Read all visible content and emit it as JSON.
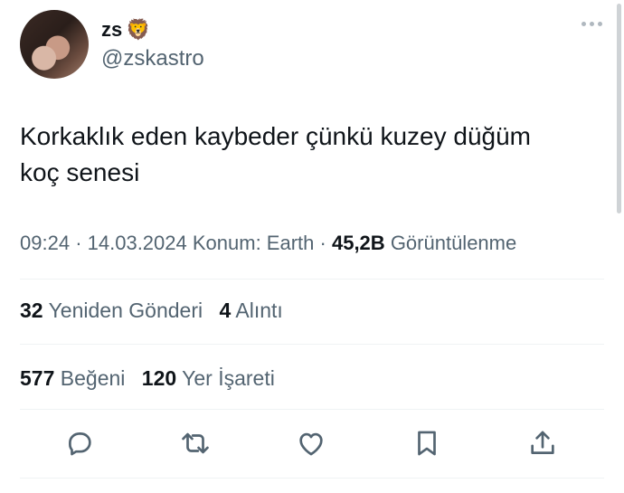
{
  "user": {
    "name": "zs",
    "emoji": "🦁",
    "handle": "@zskastro"
  },
  "tweet": {
    "text_line1": "Korkaklık eden kaybeder çünkü kuzey düğüm",
    "text_line2": "koç senesi"
  },
  "meta": {
    "time": "09:24",
    "date": "14.03.2024",
    "location": "Konum: Earth",
    "views_count": "45,2B",
    "views_label": "Görüntülenme"
  },
  "stats": {
    "reposts_count": "32",
    "reposts_label": "Yeniden Gönderi",
    "quotes_count": "4",
    "quotes_label": "Alıntı",
    "likes_count": "577",
    "likes_label": "Beğeni",
    "bookmarks_count": "120",
    "bookmarks_label": "Yer İşareti"
  },
  "actions": {
    "reply_icon": "reply-icon",
    "repost_icon": "repost-icon",
    "like_icon": "like-icon",
    "bookmark_icon": "bookmark-icon",
    "share_icon": "share-icon"
  }
}
